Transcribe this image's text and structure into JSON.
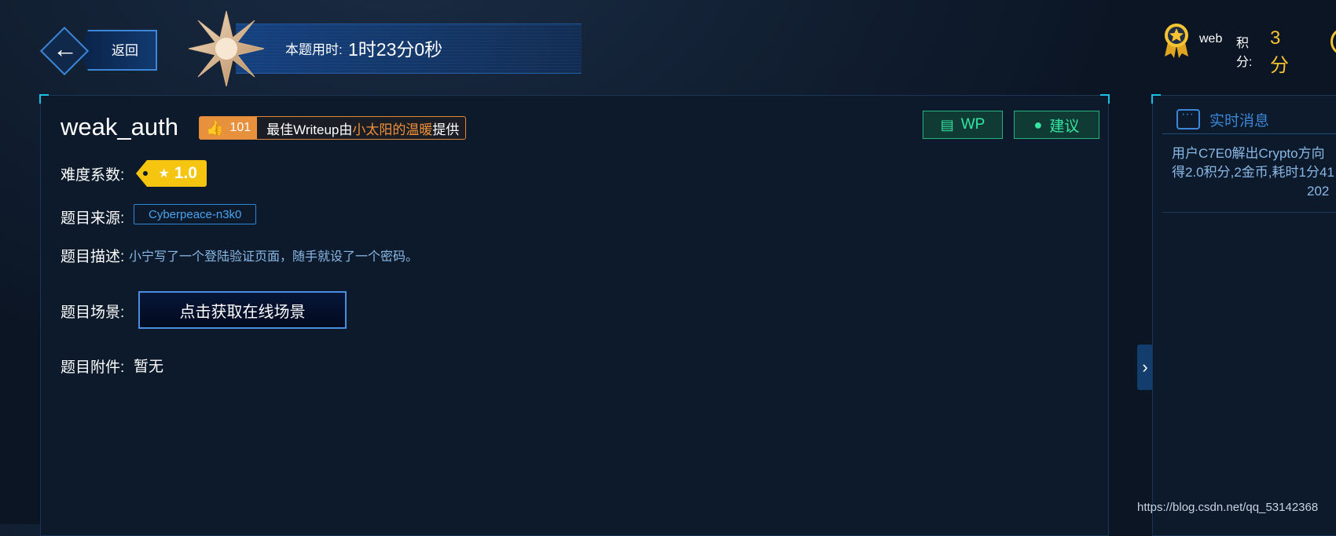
{
  "header": {
    "back_label": "返回",
    "timer_label": "本题用时:",
    "timer_value": "1时23分0秒",
    "user_name": "web",
    "points_label": "积分:",
    "points_value": "3分"
  },
  "challenge": {
    "title": "weak_auth",
    "likes": "101",
    "writeup_prefix": "最佳Writeup由",
    "writeup_author": "小太阳的温暖",
    "writeup_suffix": "提供",
    "wp_label": "WP",
    "suggest_label": "建议",
    "difficulty_label": "难度系数:",
    "difficulty_value": "1.0",
    "source_label": "题目来源:",
    "source_value": "Cyberpeace-n3k0",
    "desc_label": "题目描述:",
    "desc_value": "小宁写了一个登陆验证页面，随手就设了一个密码。",
    "scene_label": "题目场景:",
    "scene_button": "点击获取在线场景",
    "attach_label": "题目附件:",
    "attach_value": "暂无"
  },
  "news": {
    "title": "实时消息",
    "lines": [
      "用户C7E0解出Crypto方向",
      "得2.0积分,2金币,耗时1分41",
      "202"
    ]
  },
  "watermark": "https://blog.csdn.net/qq_53142368",
  "colors": {
    "accent_blue": "#3b86d6",
    "gold": "#f5c433",
    "green": "#35e6a2",
    "orange": "#e8913d"
  }
}
